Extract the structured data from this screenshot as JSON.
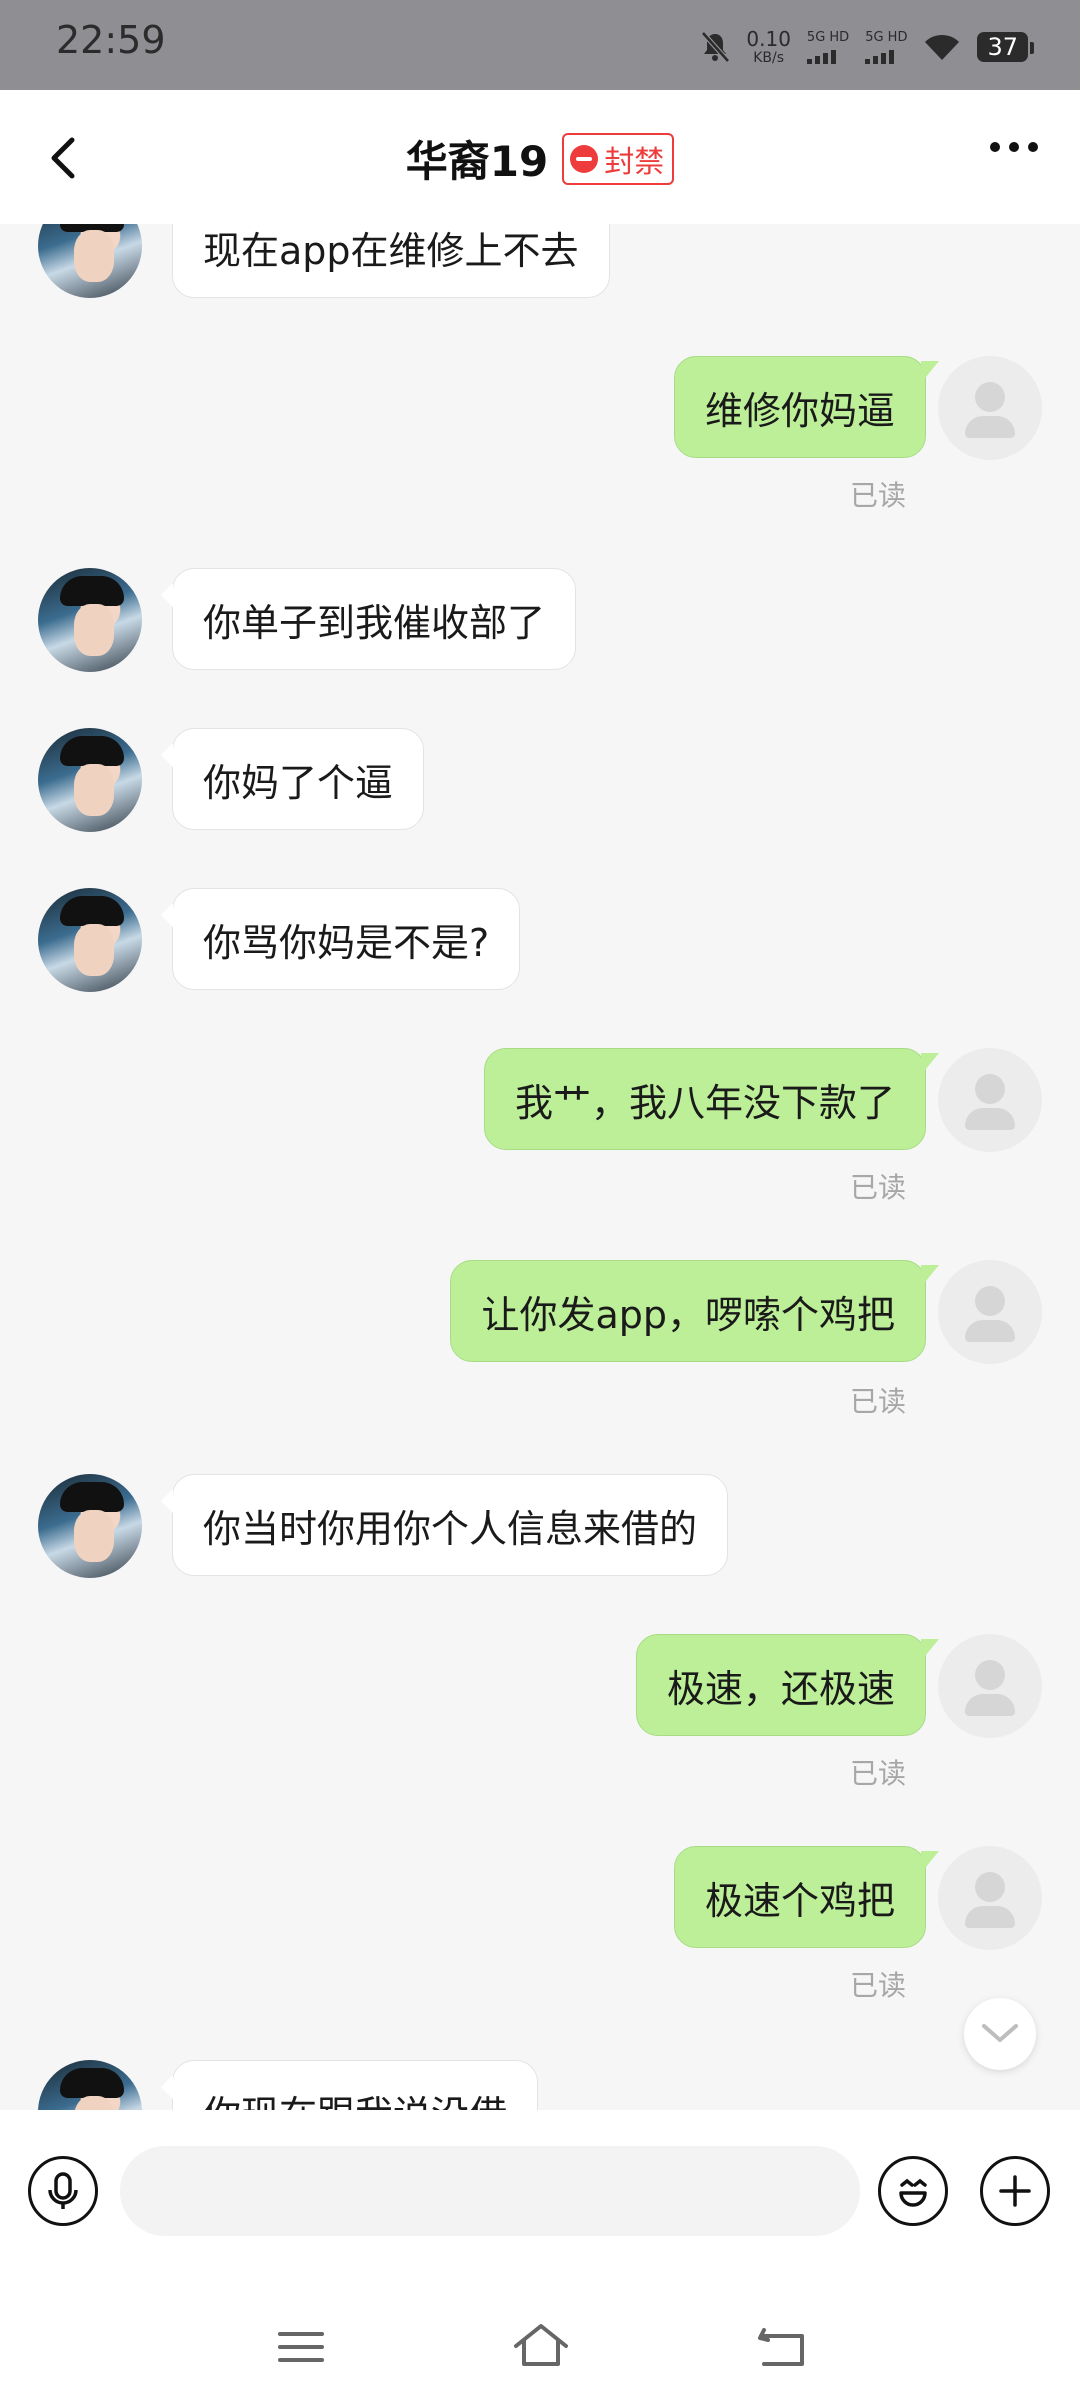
{
  "status_bar": {
    "time": "22:59",
    "net_speed": "0.10",
    "net_unit": "KB/s",
    "sim1": "5G HD",
    "sim2": "5G HD",
    "battery": "37"
  },
  "header": {
    "title": "华裔19",
    "badge": "封禁",
    "back_icon": "chevron-left-icon",
    "more_icon": "more-dots-icon"
  },
  "messages": [
    {
      "side": "in",
      "text": "现在app在维修上不去"
    },
    {
      "side": "out",
      "text": "维修你妈逼",
      "status": "已读"
    },
    {
      "side": "in",
      "text": "你单子到我催收部了"
    },
    {
      "side": "in",
      "text": "你妈了个逼"
    },
    {
      "side": "in",
      "text": "你骂你妈是不是?"
    },
    {
      "side": "out",
      "text": "我艹，我八年没下款了",
      "status": "已读"
    },
    {
      "side": "out",
      "text": "让你发app，啰嗦个鸡把",
      "status": "已读"
    },
    {
      "side": "in",
      "text": "你当时你用你个人信息来借的"
    },
    {
      "side": "out",
      "text": "极速，还极速",
      "status": "已读"
    },
    {
      "side": "out",
      "text": "极速个鸡把",
      "status": "已读"
    },
    {
      "side": "in",
      "text": "你现在跟我说没借"
    }
  ],
  "input_bar": {
    "voice_icon": "microphone-icon",
    "emoji_icon": "emoji-icon",
    "plus_icon": "plus-icon",
    "placeholder": ""
  },
  "nav_bar": {
    "icons": [
      "menu-icon",
      "home-icon",
      "back-icon"
    ]
  },
  "colors": {
    "outgoing_bubble": "#bdef98",
    "incoming_bubble": "#ffffff",
    "badge": "#ee3b3b",
    "background": "#f6f6f6"
  }
}
